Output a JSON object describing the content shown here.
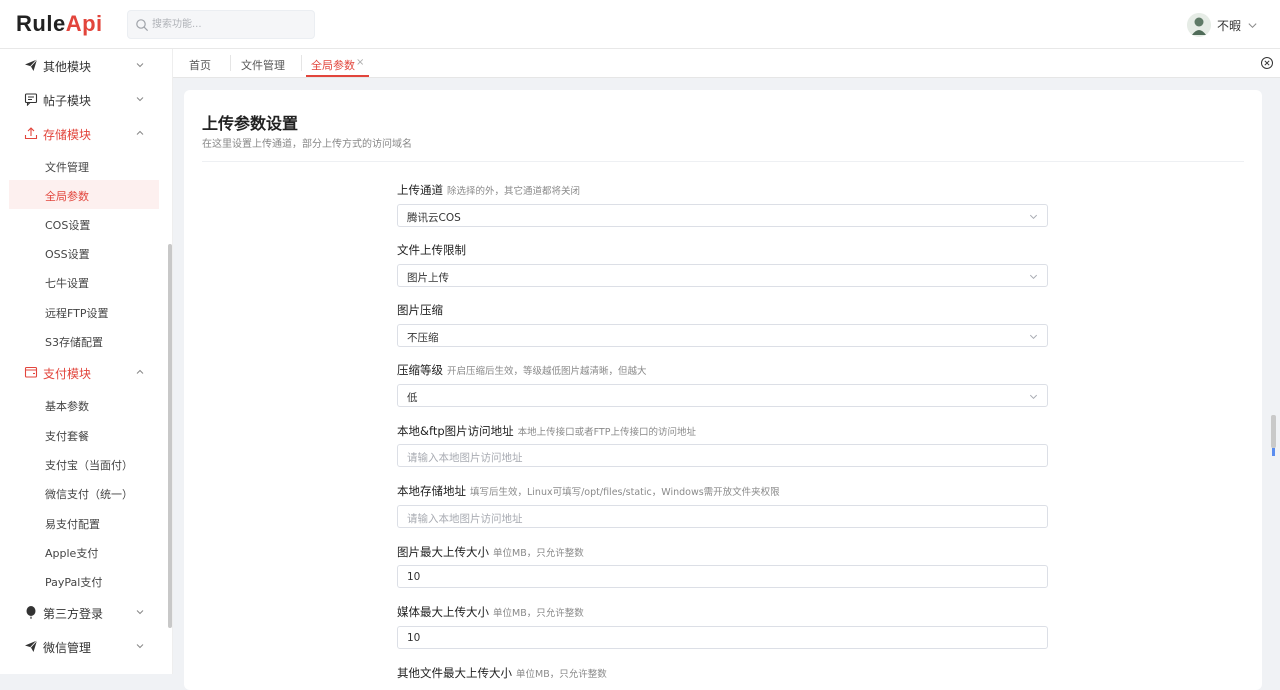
{
  "app": {
    "logo_part1": "Rule",
    "logo_part2": "Api",
    "search_placeholder": "搜索功能...",
    "user_name": "不暇",
    "accent_color": "#e2453c"
  },
  "sidebar": {
    "groups": [
      {
        "label": "其他模块",
        "icon": "send-icon",
        "expanded": false
      },
      {
        "label": "帖子模块",
        "icon": "message-icon",
        "expanded": false
      },
      {
        "label": "存储模块",
        "icon": "upload-icon",
        "expanded": true
      },
      {
        "label": "支付模块",
        "icon": "wallet-icon",
        "expanded": true
      },
      {
        "label": "第三方登录",
        "icon": "balloon-icon",
        "expanded": false
      },
      {
        "label": "微信管理",
        "icon": "send-icon",
        "expanded": false
      }
    ],
    "storage_items": [
      "文件管理",
      "全局参数",
      "COS设置",
      "OSS设置",
      "七牛设置",
      "远程FTP设置",
      "S3存储配置"
    ],
    "pay_items": [
      "基本参数",
      "支付套餐",
      "支付宝（当面付）",
      "微信支付（统一）",
      "易支付配置",
      "Apple支付",
      "PayPal支付"
    ],
    "active_item": "全局参数"
  },
  "tabs": {
    "items": [
      "首页",
      "文件管理",
      "全局参数"
    ],
    "active": "全局参数",
    "close_glyph": "×"
  },
  "page": {
    "title": "上传参数设置",
    "subtitle": "在这里设置上传通道，部分上传方式的访问域名"
  },
  "form": {
    "fields": [
      {
        "label": "上传通道",
        "hint": "除选择的外，其它通道都将关闭",
        "type": "select",
        "value": "腾讯云COS"
      },
      {
        "label": "文件上传限制",
        "hint": "",
        "type": "select",
        "value": "图片上传"
      },
      {
        "label": "图片压缩",
        "hint": "",
        "type": "select",
        "value": "不压缩"
      },
      {
        "label": "压缩等级",
        "hint": "开启压缩后生效，等级越低图片越清晰，但越大",
        "type": "select",
        "value": "低"
      },
      {
        "label": "本地&ftp图片访问地址",
        "hint": "本地上传接口或者FTP上传接口的访问地址",
        "type": "input",
        "value": "",
        "placeholder": "请输入本地图片访问地址"
      },
      {
        "label": "本地存储地址",
        "hint": "填写后生效，Linux可填写/opt/files/static，Windows需开放文件夹权限",
        "type": "input",
        "value": "",
        "placeholder": "请输入本地图片访问地址"
      },
      {
        "label": "图片最大上传大小",
        "hint": "单位MB，只允许整数",
        "type": "input",
        "value": "10"
      },
      {
        "label": "媒体最大上传大小",
        "hint": "单位MB，只允许整数",
        "type": "input",
        "value": "10"
      },
      {
        "label": "其他文件最大上传大小",
        "hint": "单位MB，只允许整数",
        "type": "input",
        "value": ""
      }
    ]
  }
}
